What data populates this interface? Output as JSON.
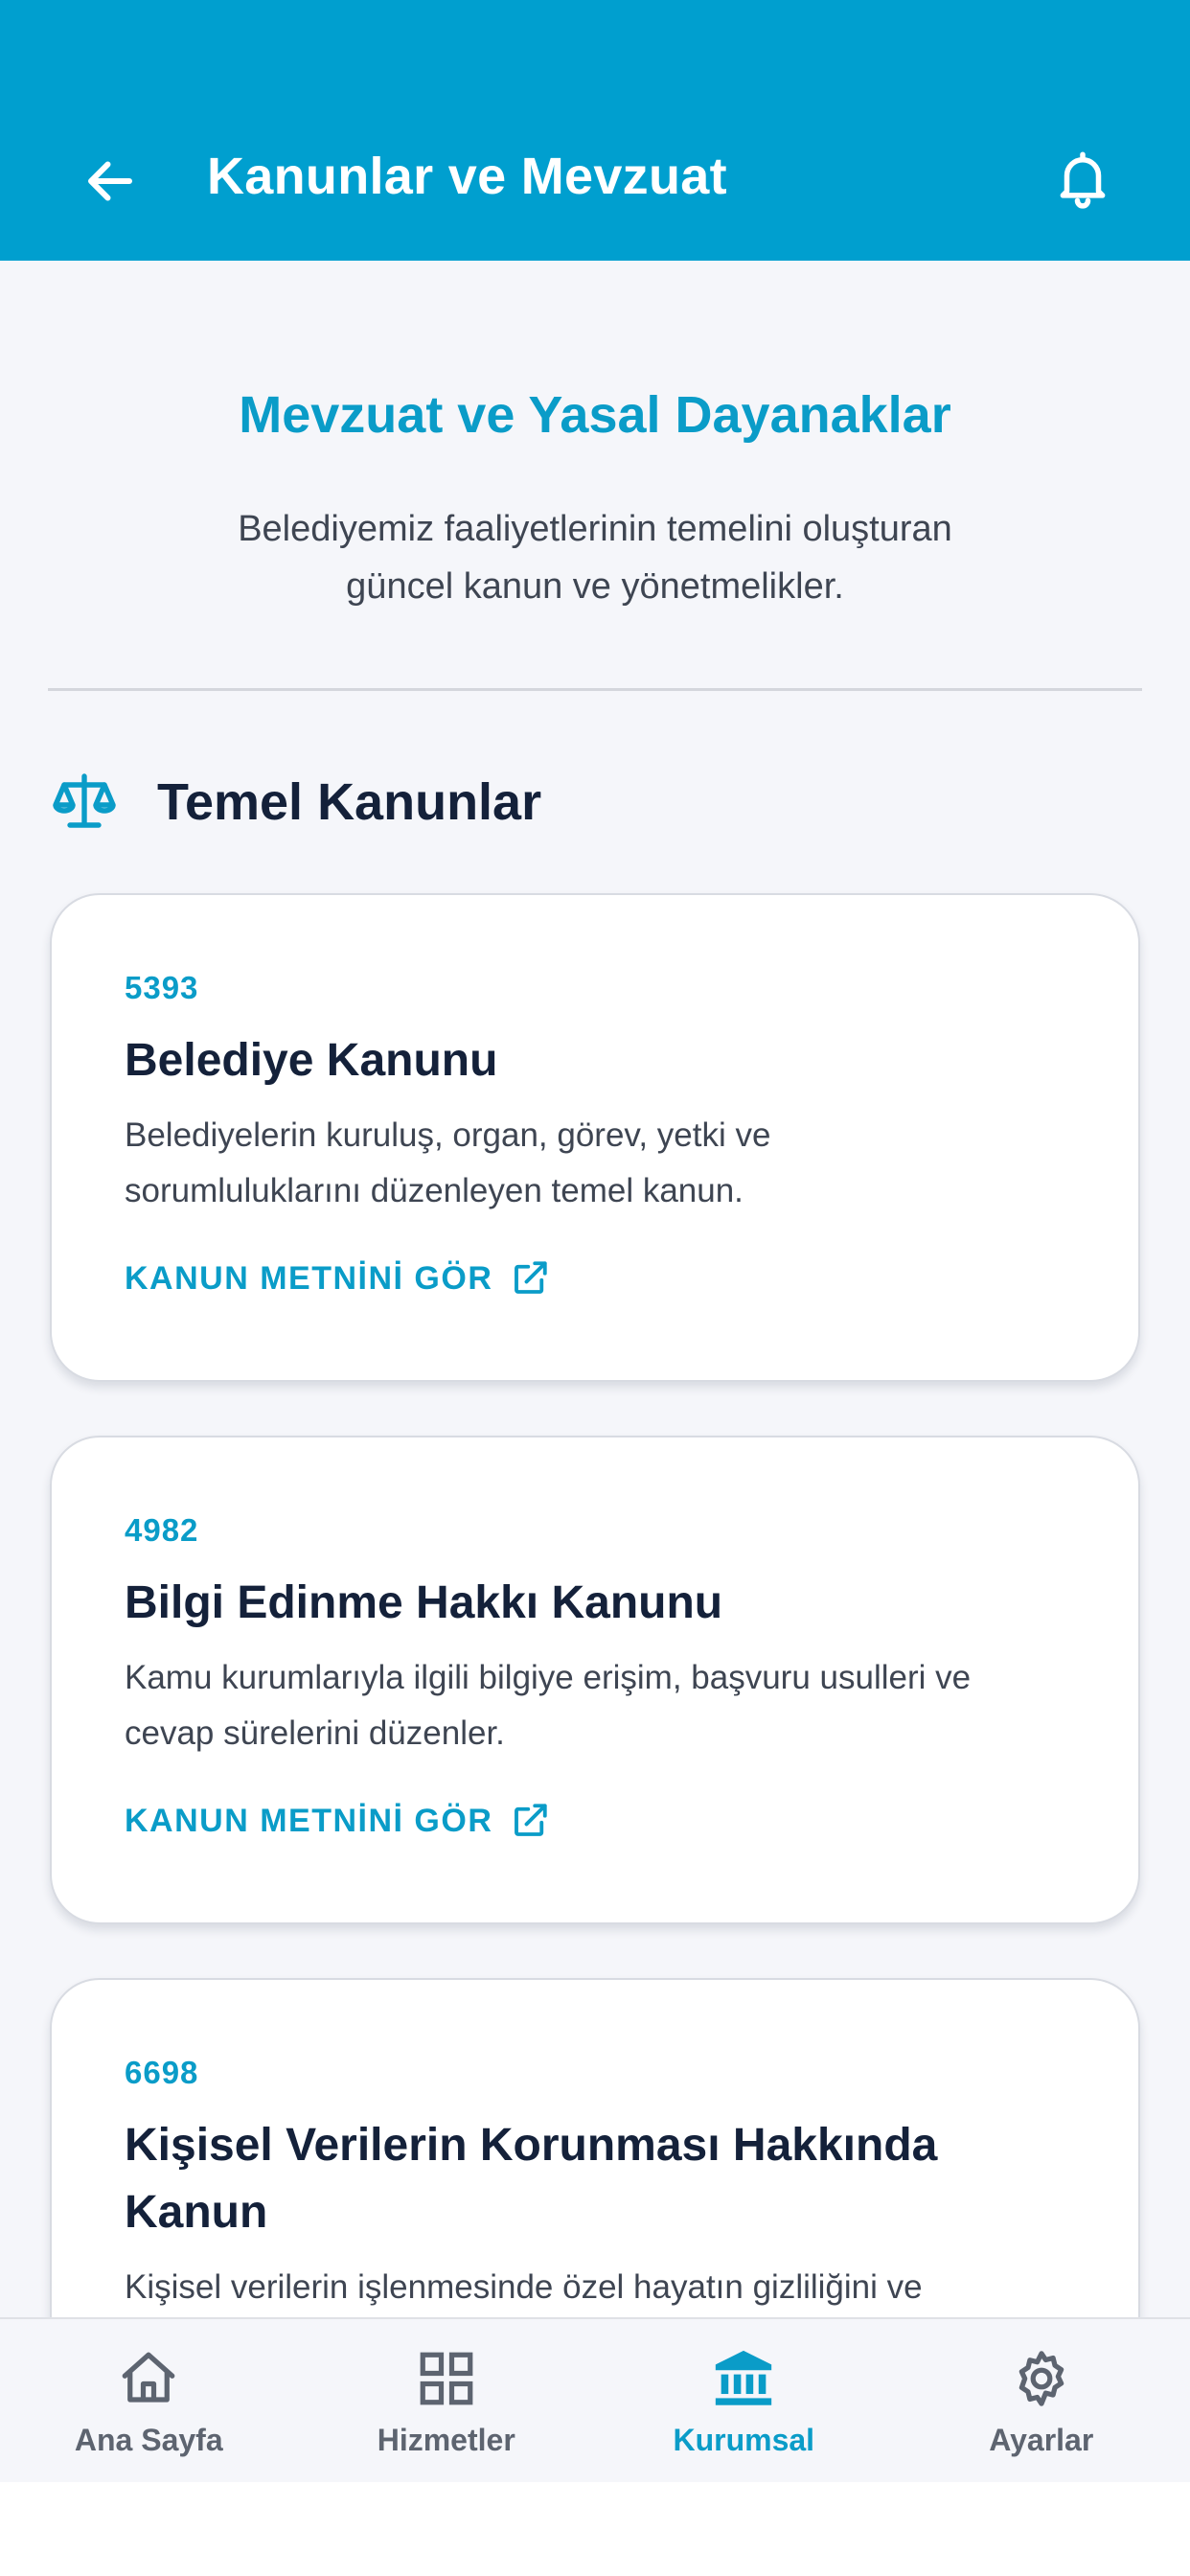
{
  "header": {
    "title": "Kanunlar ve Mevzuat",
    "back_icon": "arrow-left-icon",
    "bell_icon": "bell-icon"
  },
  "hero": {
    "title": "Mevzuat ve Yasal Dayanaklar",
    "subtitle_line1": "Belediyemiz faaliyetlerinin temelini oluşturan",
    "subtitle_line2": "güncel kanun ve yönetmelikler."
  },
  "section": {
    "icon": "scale-icon",
    "title": "Temel Kanunlar"
  },
  "laws": [
    {
      "number": "5393",
      "title": "Belediye Kanunu",
      "desc_line1": "Belediyelerin kuruluş, organ, görev, yetki ve",
      "desc_line2": "sorumluluklarını düzenleyen temel kanun.",
      "link": "KANUN METNİNİ GÖR"
    },
    {
      "number": "4982",
      "title": "Bilgi Edinme Hakkı Kanunu",
      "desc_line1": "Kamu kurumlarıyla ilgili bilgiye erişim, başvuru usulleri ve",
      "desc_line2": "cevap sürelerini düzenler.",
      "link": "KANUN METNİNİ GÖR"
    },
    {
      "number": "6698",
      "title_line1": "Kişisel Verilerin Korunması Hakkında",
      "title_line2": "Kanun",
      "desc_line1": "Kişisel verilerin işlenmesinde özel hayatın gizliliğini ve"
    }
  ],
  "nav": [
    {
      "label": "Ana Sayfa",
      "icon": "home-icon",
      "active": false
    },
    {
      "label": "Hizmetler",
      "icon": "grid-icon",
      "active": false
    },
    {
      "label": "Kurumsal",
      "icon": "bank-icon",
      "active": true
    },
    {
      "label": "Ayarlar",
      "icon": "gear-icon",
      "active": false
    }
  ],
  "colors": {
    "primary": "#009fcf",
    "accent_text": "#0a9cc8",
    "heading": "#14213a",
    "background": "#f5f6fa"
  }
}
